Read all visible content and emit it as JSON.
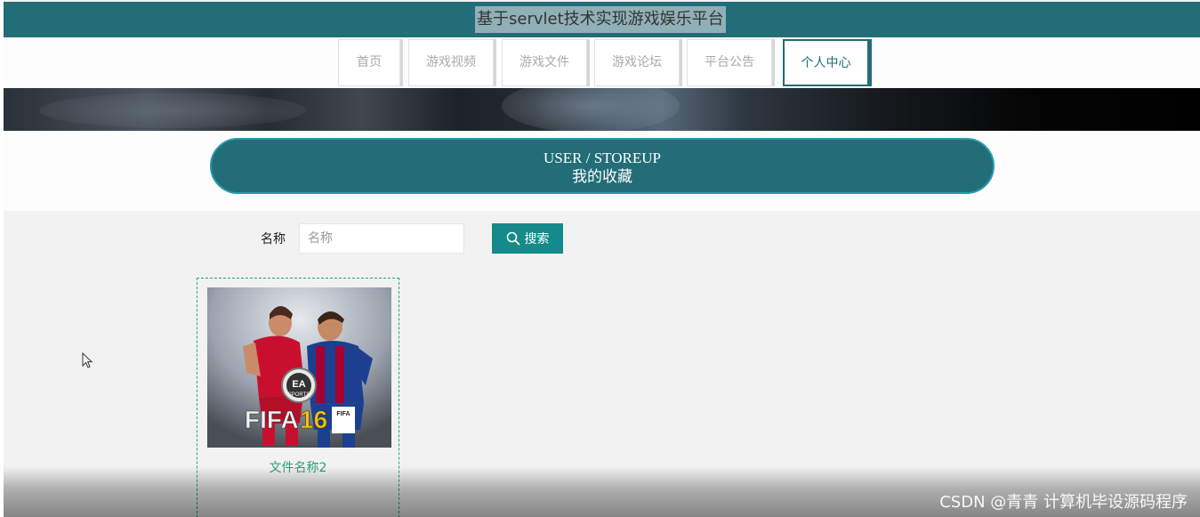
{
  "header": {
    "site_title": "基于servlet技术实现游戏娱乐平台"
  },
  "nav": {
    "items": [
      {
        "label": "首页"
      },
      {
        "label": "游戏视频"
      },
      {
        "label": "游戏文件"
      },
      {
        "label": "游戏论坛"
      },
      {
        "label": "平台公告"
      },
      {
        "label": "个人中心"
      }
    ],
    "active_label": "个人中心"
  },
  "section": {
    "title_en": "USER / STOREUP",
    "title_cn": "我的收藏"
  },
  "search": {
    "label": "名称",
    "placeholder": "名称",
    "value": "",
    "button_label": "搜索"
  },
  "favorites": [
    {
      "title": "文件名称2",
      "image_text_badge": "EA SPORTS",
      "image_text_game": "FIFA16"
    }
  ],
  "watermark": "CSDN @青青  计算机毕设源码程序",
  "colors": {
    "brand": "#226d77",
    "accent_button": "#158a8a",
    "card_border": "#26a17c"
  }
}
